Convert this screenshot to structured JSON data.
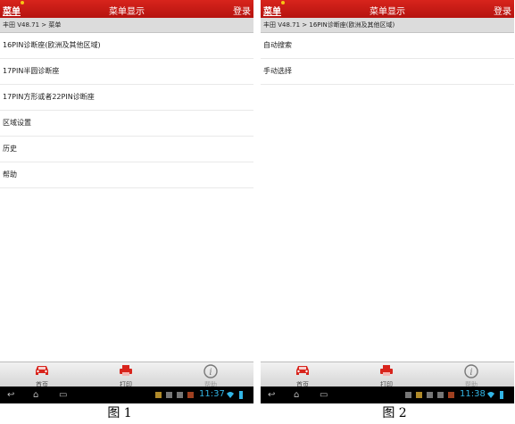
{
  "panels": [
    {
      "topbar": {
        "menu": "菜单",
        "title": "菜单显示",
        "login": "登录"
      },
      "breadcrumb": "丰田 V48.71 > 菜单",
      "items": [
        "16PIN诊断座(欧洲及其他区域)",
        "17PIN半圆诊断座",
        "17PIN方形或者22PIN诊断座",
        "区域设置",
        "历史",
        "帮助"
      ],
      "bottom_tabs": [
        {
          "label": "首页",
          "icon": "car-icon"
        },
        {
          "label": "打印",
          "icon": "printer-icon"
        },
        {
          "label": "帮助",
          "icon": "info-icon"
        }
      ],
      "status": {
        "time": "11:37"
      },
      "caption": "图 1"
    },
    {
      "topbar": {
        "menu": "菜单",
        "title": "菜单显示",
        "login": "登录"
      },
      "breadcrumb": "丰田 V48.71 > 16PIN诊断座(欧洲及其他区域)",
      "items": [
        "自动搜索",
        "手动选择"
      ],
      "bottom_tabs": [
        {
          "label": "首页",
          "icon": "car-icon"
        },
        {
          "label": "打印",
          "icon": "printer-icon"
        },
        {
          "label": "帮助",
          "icon": "info-icon"
        }
      ],
      "status": {
        "time": "11:38"
      },
      "caption": "图 2"
    }
  ],
  "colors": {
    "topbar": "#c81a14",
    "accent_red": "#d8241c",
    "clock": "#33b5e5"
  }
}
